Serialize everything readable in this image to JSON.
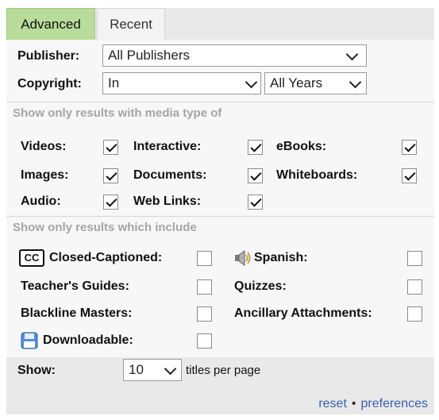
{
  "tabs": [
    {
      "label": "Advanced",
      "active": true
    },
    {
      "label": "Recent",
      "active": false
    }
  ],
  "publisher": {
    "label": "Publisher:",
    "value": "All Publishers"
  },
  "copyright": {
    "label": "Copyright:",
    "operator": "In",
    "value": "All Years"
  },
  "media_section": {
    "title": "Show only results with media type of",
    "items": [
      {
        "label": "Videos:",
        "checked": true
      },
      {
        "label": "Interactive:",
        "checked": true
      },
      {
        "label": "eBooks:",
        "checked": true
      },
      {
        "label": "Images:",
        "checked": true
      },
      {
        "label": "Documents:",
        "checked": true
      },
      {
        "label": "Whiteboards:",
        "checked": true
      },
      {
        "label": "Audio:",
        "checked": true
      },
      {
        "label": "Web Links:",
        "checked": true
      }
    ]
  },
  "include_section": {
    "title": "Show only results which include",
    "cc_badge": "CC",
    "items": [
      {
        "label": "Closed-Captioned:",
        "checked": false,
        "icon": "closed-captioned-icon"
      },
      {
        "label": "Spanish:",
        "checked": false,
        "icon": "speaker-icon"
      },
      {
        "label": "Teacher's Guides:",
        "checked": false
      },
      {
        "label": "Quizzes:",
        "checked": false
      },
      {
        "label": "Blackline Masters:",
        "checked": false
      },
      {
        "label": "Ancillary Attachments:",
        "checked": false
      },
      {
        "label": "Downloadable:",
        "checked": false,
        "icon": "disk-icon"
      }
    ]
  },
  "show": {
    "label": "Show:",
    "value": "10",
    "suffix": "titles per page"
  },
  "footer": {
    "reset": "reset",
    "separator": "•",
    "preferences": "preferences"
  },
  "colors": {
    "active_tab": "#b8dd9a",
    "link": "#3a60b0",
    "section_title": "#a5a5a5"
  }
}
